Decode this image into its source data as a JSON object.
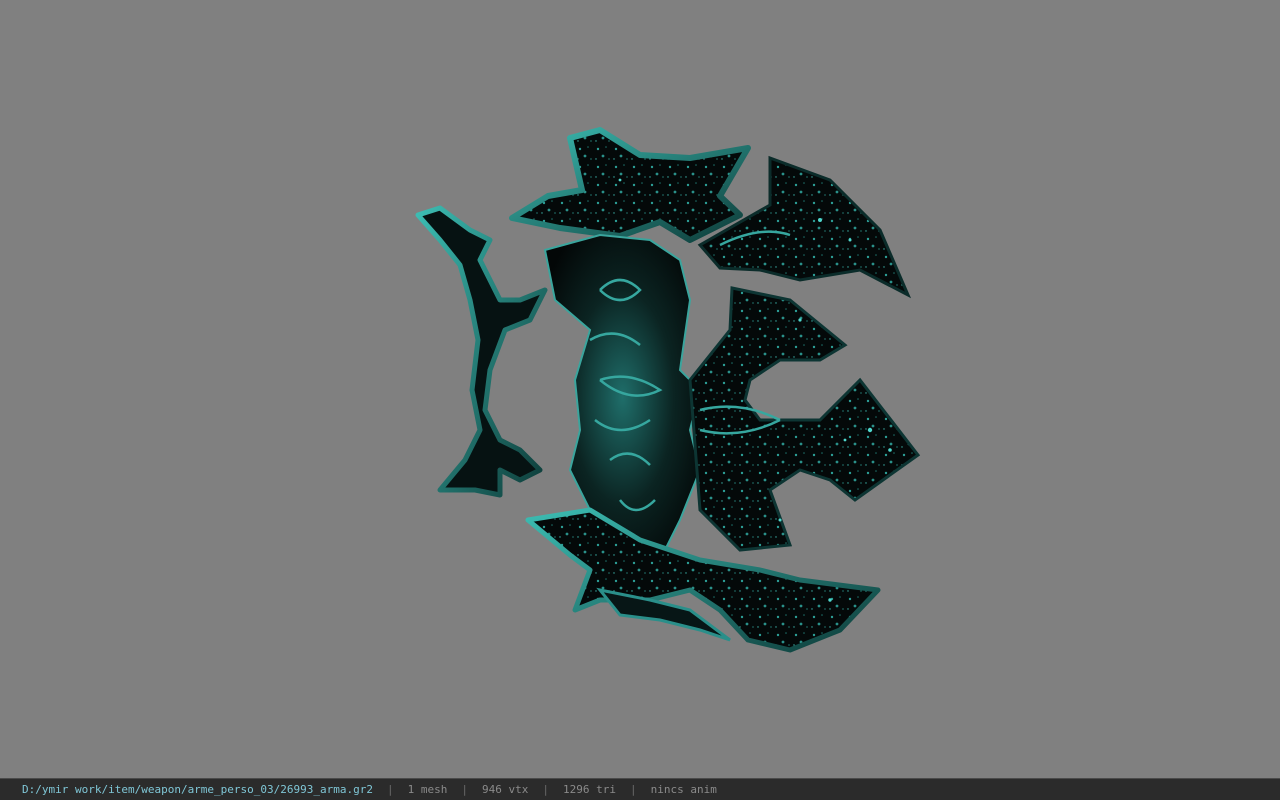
{
  "viewer": {
    "background_color": "#808080",
    "model": {
      "icon": "weapon-model",
      "base_color": "#050a0a",
      "accent_color": "#2a8f8a",
      "highlight_color": "#4fd6cc"
    }
  },
  "statusbar": {
    "file_path": "D:/ymir work/item/weapon/arme_perso_03/26993_arma.gr2",
    "mesh_count": "1 mesh",
    "vertex_count": "946 vtx",
    "triangle_count": "1296 tri",
    "anim_status": "nincs anim",
    "separator": "|"
  }
}
